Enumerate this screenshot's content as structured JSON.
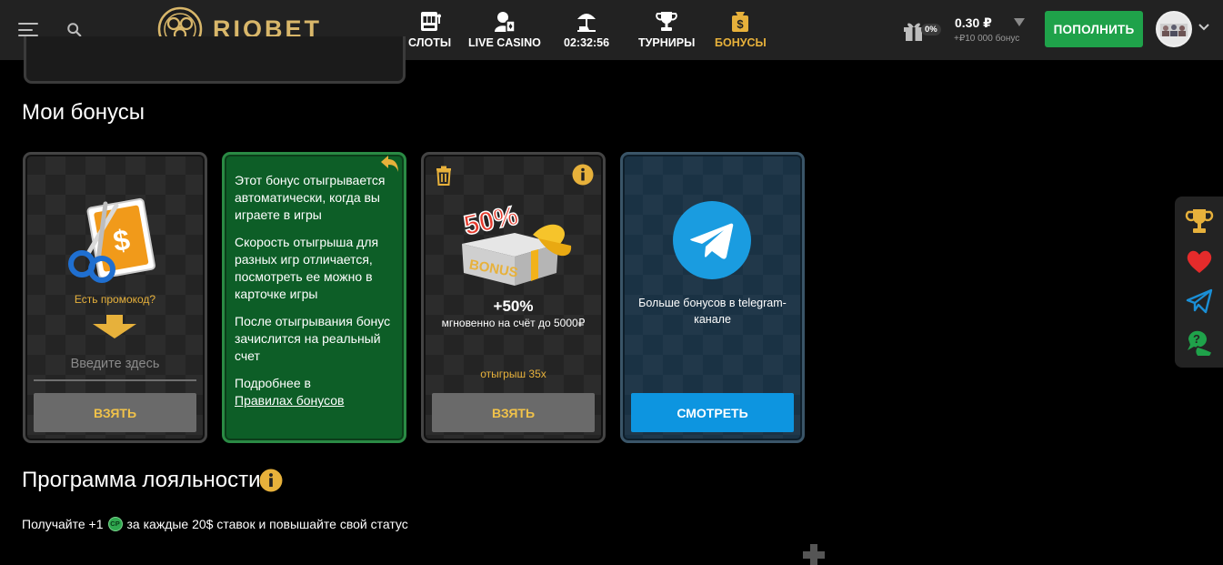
{
  "header": {
    "brand": "RIOBET",
    "nav": [
      {
        "label": "СЛОТЫ",
        "icon": "slot-machine-icon"
      },
      {
        "label": "LIVE CASINO",
        "icon": "live-dealer-icon"
      },
      {
        "label": "02:32:56",
        "icon": "beach-umbrella-icon"
      },
      {
        "label": "ТУРНИРЫ",
        "icon": "trophy-icon"
      },
      {
        "label": "БОНУСЫ",
        "icon": "bonus-bag-icon"
      }
    ],
    "gift_percent": "0%",
    "balance": "0.30 ₽",
    "bonus_balance": "+₽10 000 бонус",
    "deposit_label": "ПОПОЛНИТЬ"
  },
  "sections": {
    "my_bonuses": "Мои бонусы",
    "loyalty": "Программа лояльности",
    "loyalty_sub_before": "Получайте +1",
    "loyalty_coin": "CP",
    "loyalty_sub_after": "за каждые 20$ ставок и повышайте свой статус"
  },
  "cards": {
    "promo": {
      "question": "Есть промокод?",
      "placeholder": "Введите здесь",
      "button": "ВЗЯТЬ"
    },
    "info": {
      "p1": "Этот бонус отыгрывается автоматически, когда вы играете в игры",
      "p2": "Скорость отыгрыша для разных игр отличается, посмотреть ее можно в карточке игры",
      "p3": "После отыгрывания бонус зачислится на реальный счет",
      "p4_text": "Подробнее в",
      "p4_link": "Правилах бонусов"
    },
    "bonus": {
      "image_text": "50%",
      "image_word": "BONUS",
      "percent": "+50%",
      "desc": "мгновенно на счёт до 5000₽",
      "wager": "отыгрыш 35x",
      "button": "ВЗЯТЬ"
    },
    "telegram": {
      "text": "Больше бонусов в telegram-канале",
      "button": "СМОТРЕТЬ"
    }
  },
  "colors": {
    "accent_gold": "#e7b13b",
    "deposit_green": "#1fa24a",
    "telegram_blue": "#0d95e0",
    "header_bg": "#222222"
  }
}
